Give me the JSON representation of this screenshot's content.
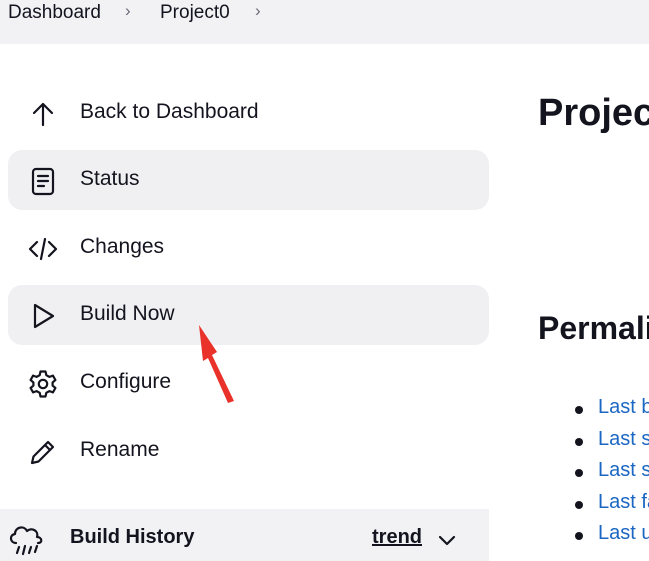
{
  "breadcrumb": {
    "items": [
      "Dashboard",
      "Project0"
    ],
    "separator": "›"
  },
  "sidebar": {
    "items": [
      {
        "label": "Back to Dashboard",
        "icon": "arrow-up-icon"
      },
      {
        "label": "Status",
        "icon": "document-icon"
      },
      {
        "label": "Changes",
        "icon": "code-icon"
      },
      {
        "label": "Build Now",
        "icon": "play-icon"
      },
      {
        "label": "Configure",
        "icon": "gear-icon"
      },
      {
        "label": "Rename",
        "icon": "pencil-icon"
      }
    ]
  },
  "build_history": {
    "label": "Build History",
    "trend_label": "trend",
    "icon": "cloud-rain-icon"
  },
  "main": {
    "title": "Project",
    "permalinks_title": "Permali",
    "permalinks": [
      "Last b",
      "Last s",
      "Last s",
      "Last fa",
      "Last u"
    ]
  },
  "colors": {
    "link": "#1a66c2",
    "highlight": "#f0f0f3",
    "annotation_arrow": "#e8322a"
  }
}
